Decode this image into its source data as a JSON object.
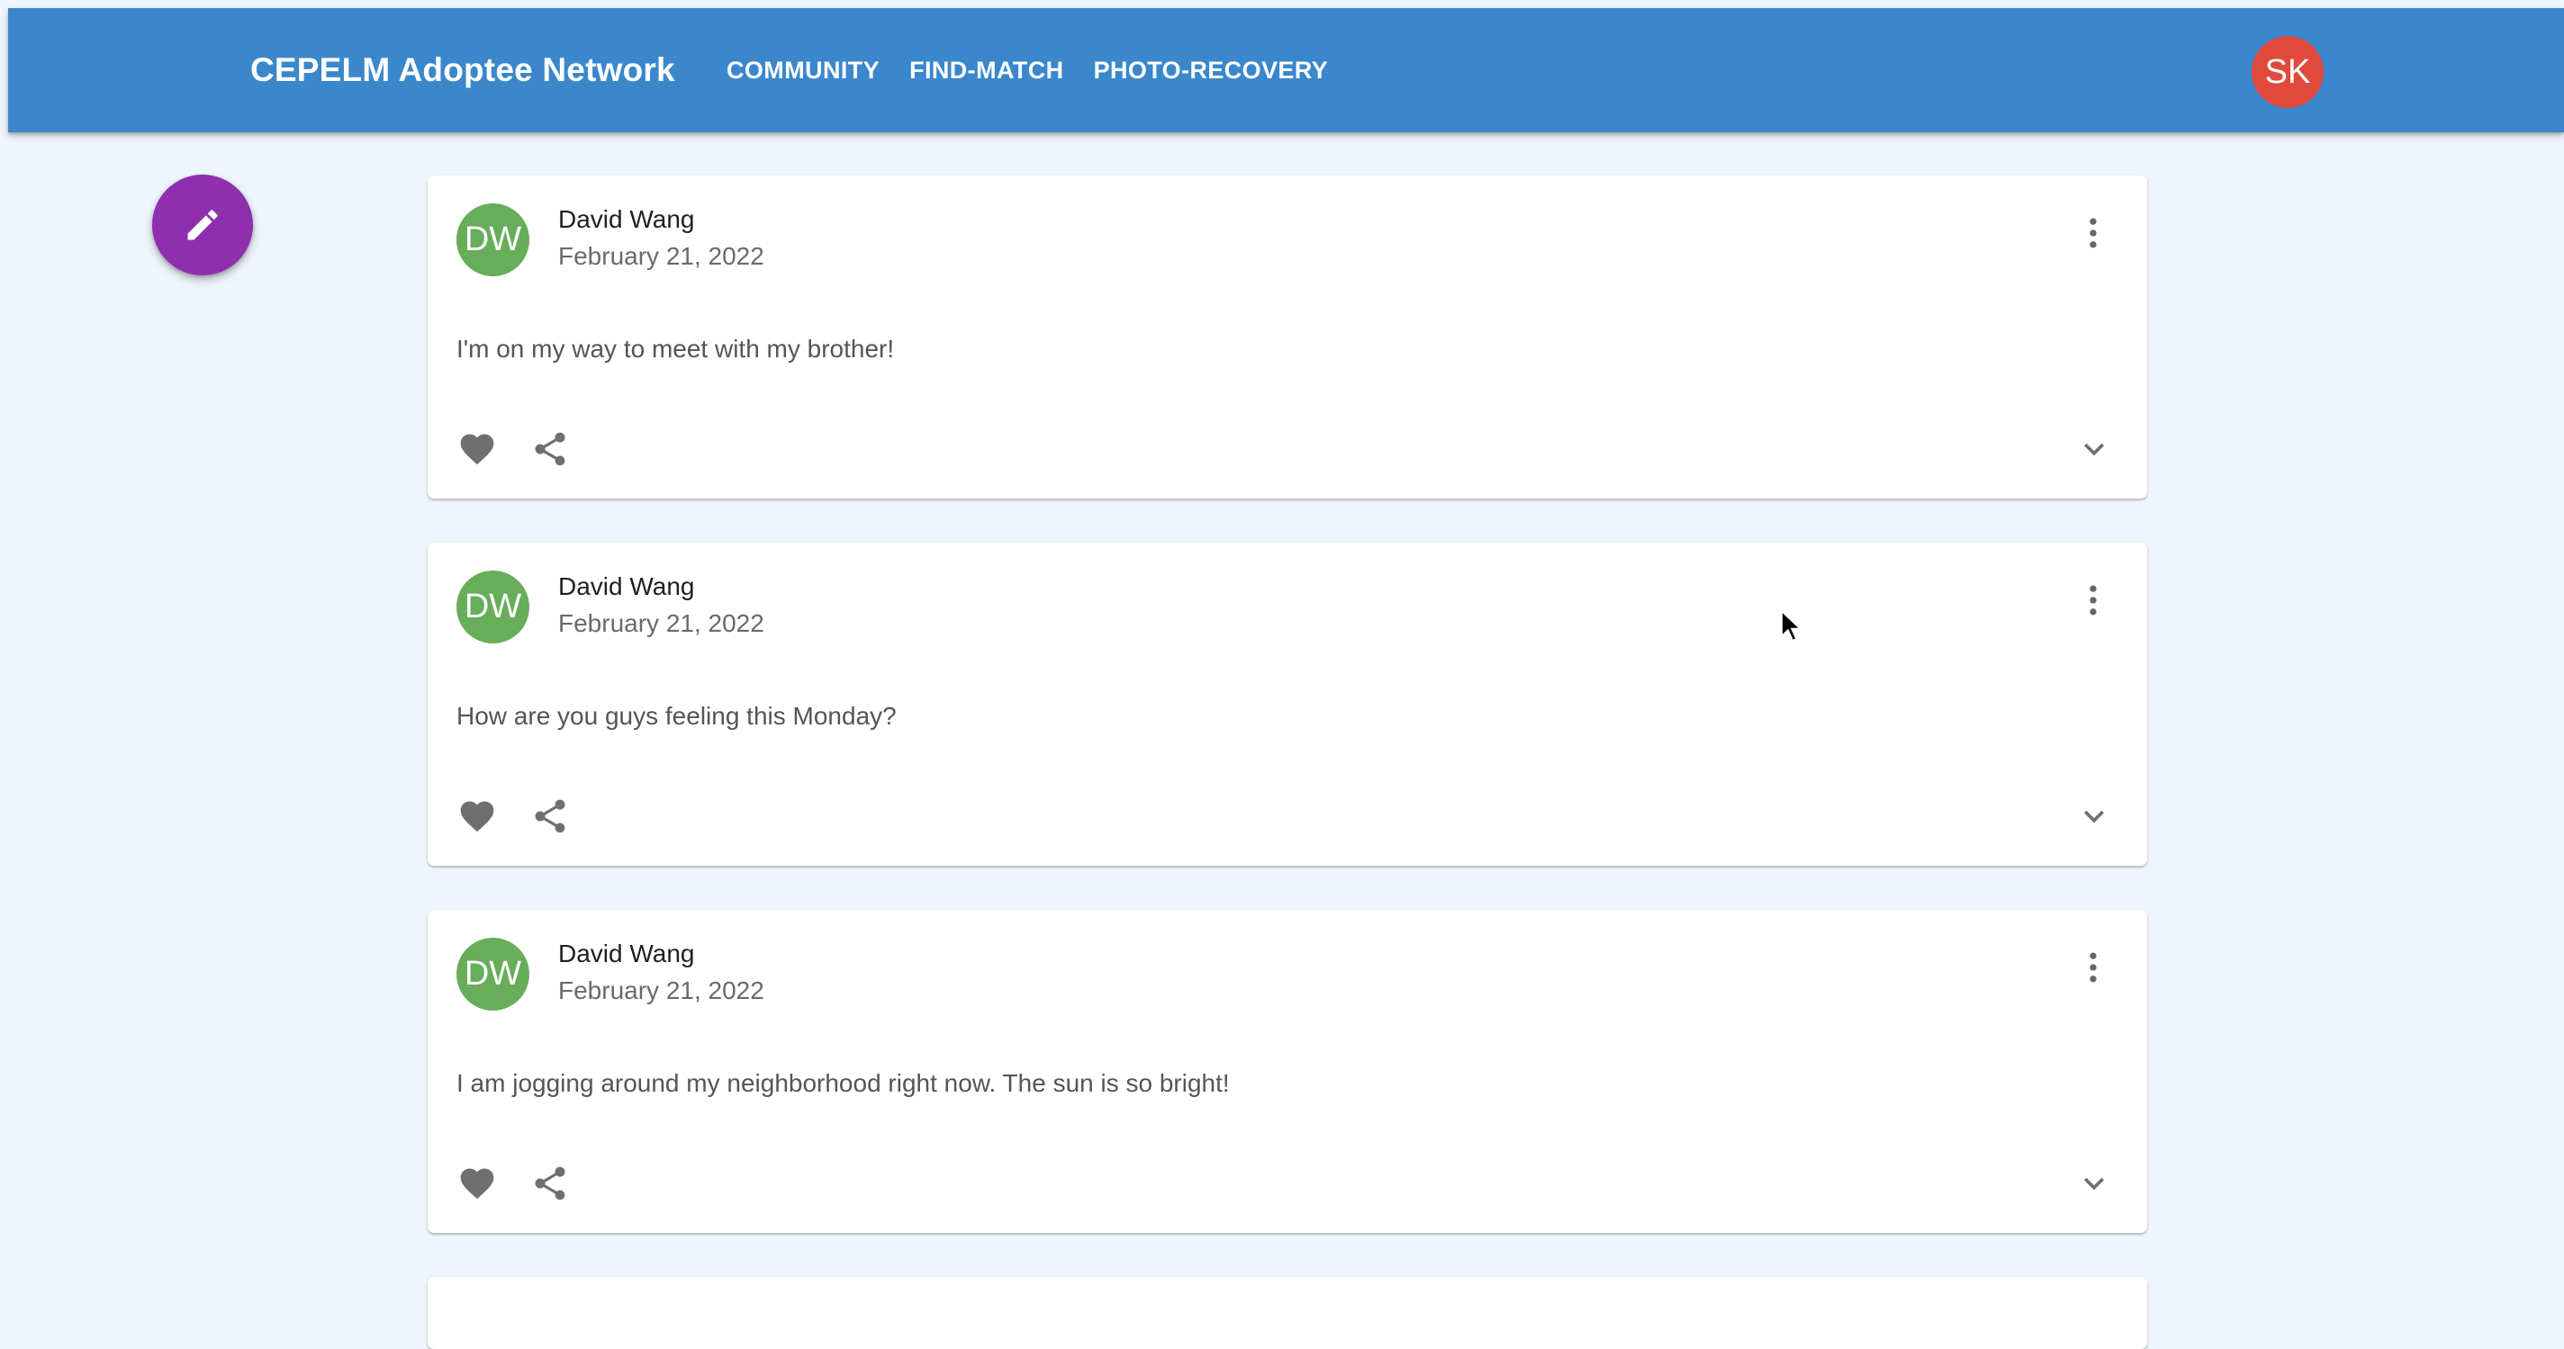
{
  "app": {
    "title": "CEPELM Adoptee Network",
    "nav": [
      "COMMUNITY",
      "FIND-MATCH",
      "PHOTO-RECOVERY"
    ],
    "user_initials": "SK"
  },
  "colors": {
    "appbar": "#3a87cc",
    "user_avatar": "#e04a3d",
    "fab": "#8e2fae",
    "author_avatar": "#67ad5a",
    "background": "#eef5fc"
  },
  "icons": {
    "fab": "pencil-icon",
    "menu": "more-vert-icon",
    "like": "heart-icon",
    "share": "share-icon",
    "expand": "chevron-down-icon"
  },
  "posts": [
    {
      "initials": "DW",
      "author": "David Wang",
      "date": "February 21, 2022",
      "text": "I'm on my way to meet with my brother!"
    },
    {
      "initials": "DW",
      "author": "David Wang",
      "date": "February 21, 2022",
      "text": "How are you guys feeling this Monday?"
    },
    {
      "initials": "DW",
      "author": "David Wang",
      "date": "February 21, 2022",
      "text": "I am jogging around my neighborhood right now. The sun is so bright!"
    }
  ]
}
